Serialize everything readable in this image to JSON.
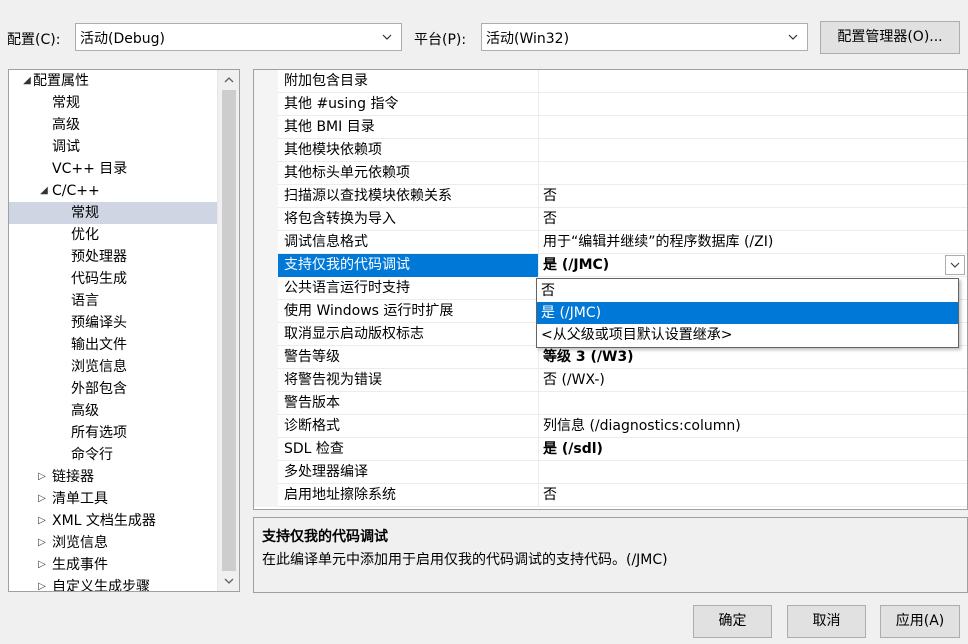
{
  "top": {
    "config_label": "配置(C):",
    "config_value": "活动(Debug)",
    "platform_label": "平台(P):",
    "platform_value": "活动(Win32)",
    "config_manager_button": "配置管理器(O)..."
  },
  "tree": {
    "items": [
      {
        "label": "配置属性",
        "expander": "◢"
      },
      {
        "label": "常规"
      },
      {
        "label": "高级"
      },
      {
        "label": "调试"
      },
      {
        "label": "VC++ 目录"
      },
      {
        "label": "C/C++",
        "expander": "◢"
      },
      {
        "label": "常规"
      },
      {
        "label": "优化"
      },
      {
        "label": "预处理器"
      },
      {
        "label": "代码生成"
      },
      {
        "label": "语言"
      },
      {
        "label": "预编译头"
      },
      {
        "label": "输出文件"
      },
      {
        "label": "浏览信息"
      },
      {
        "label": "外部包含"
      },
      {
        "label": "高级"
      },
      {
        "label": "所有选项"
      },
      {
        "label": "命令行"
      },
      {
        "label": "链接器",
        "expander": "▷"
      },
      {
        "label": "清单工具",
        "expander": "▷"
      },
      {
        "label": "XML 文档生成器",
        "expander": "▷"
      },
      {
        "label": "浏览信息",
        "expander": "▷"
      },
      {
        "label": "生成事件",
        "expander": "▷"
      },
      {
        "label": "自定义生成步骤",
        "expander": "▷"
      }
    ]
  },
  "properties": [
    {
      "name": "附加包含目录",
      "value": ""
    },
    {
      "name": "其他 #using 指令",
      "value": ""
    },
    {
      "name": "其他 BMI 目录",
      "value": ""
    },
    {
      "name": "其他模块依赖项",
      "value": ""
    },
    {
      "name": "其他标头单元依赖项",
      "value": ""
    },
    {
      "name": "扫描源以查找模块依赖关系",
      "value": "否"
    },
    {
      "name": "将包含转换为导入",
      "value": "否"
    },
    {
      "name": "调试信息格式",
      "value": "用于“编辑并继续”的程序数据库 (/ZI)"
    },
    {
      "name": "支持仅我的代码调试",
      "value": "是 (/JMC)"
    },
    {
      "name": "公共语言运行时支持",
      "value": ""
    },
    {
      "name": "使用 Windows 运行时扩展",
      "value": ""
    },
    {
      "name": "取消显示启动版权标志",
      "value": ""
    },
    {
      "name": "警告等级",
      "value": "等级 3 (/W3)"
    },
    {
      "name": "将警告视为错误",
      "value": "否 (/WX-)"
    },
    {
      "name": "警告版本",
      "value": ""
    },
    {
      "name": "诊断格式",
      "value": "列信息 (/diagnostics:column)"
    },
    {
      "name": "SDL 检查",
      "value": "是 (/sdl)"
    },
    {
      "name": "多处理器编译",
      "value": ""
    },
    {
      "name": "启用地址擦除系统",
      "value": "否"
    }
  ],
  "dropdown_options": [
    "否",
    "是 (/JMC)",
    "<从父级或项目默认设置继承>"
  ],
  "description": {
    "title": "支持仅我的代码调试",
    "text": "在此编译单元中添加用于启用仅我的代码调试的支持代码。(/JMC)"
  },
  "buttons": {
    "ok": "确定",
    "cancel": "取消",
    "apply": "应用(A)"
  },
  "colors": {
    "selection": "#0078d7",
    "tree_selection": "#cfd5e3",
    "background": "#f0f0f0"
  }
}
